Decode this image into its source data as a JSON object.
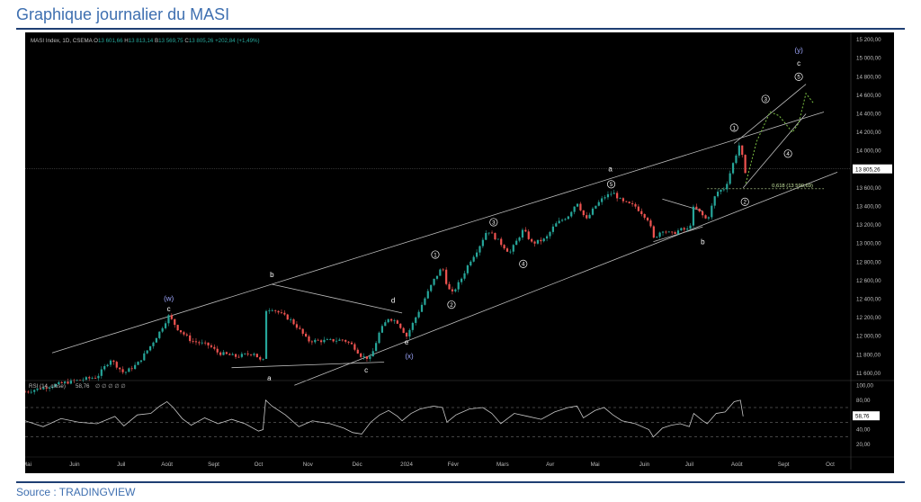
{
  "page_title": "Graphique journalier du MASI",
  "source": "Source : TRADINGVIEW",
  "colors": {
    "up": "#26a69a",
    "down": "#ef5350",
    "rsi": "#c8c8c8",
    "rsi_ob": "#26a69a",
    "fib": "#c8e6a0",
    "forecast": "#7bc043",
    "wave_label": "#ffffff",
    "wave_major": "#9fa8ff",
    "line": "#bdbdbd"
  },
  "chart_data": {
    "type": "candlestick",
    "header": {
      "symbol": "MASI Index, 1D, CSEMA",
      "open_label": "O",
      "open": "13 601,66",
      "high_label": "H",
      "high": "13 813,14",
      "low_label": "B",
      "low": "13 569,75",
      "close_label": "C",
      "close": "13 805,26",
      "change": "+202,84 (+1,49%)"
    },
    "price_ticks": [
      "15 200,00",
      "15 000,00",
      "14 800,00",
      "14 600,00",
      "14 400,00",
      "14 200,00",
      "14 000,00",
      "13 800,00",
      "13 600,00",
      "13 400,00",
      "13 200,00",
      "13 000,00",
      "12 800,00",
      "12 600,00",
      "12 400,00",
      "12 200,00",
      "12 000,00",
      "11 800,00",
      "11 600,00"
    ],
    "price_tick_values": [
      15200,
      15000,
      14800,
      14600,
      14400,
      14200,
      14000,
      13800,
      13600,
      13400,
      13200,
      13000,
      12800,
      12600,
      12400,
      12200,
      12000,
      11800,
      11600
    ],
    "ylim": [
      11550,
      15240
    ],
    "last_price_label": "13 805,26",
    "last_price": 13805.26,
    "months": [
      "Mai",
      "Juin",
      "Juil",
      "Août",
      "Sept",
      "Oct",
      "Nov",
      "Déc",
      "2024",
      "Févr",
      "Mars",
      "Avr",
      "Mai",
      "Juin",
      "Juil",
      "Août",
      "Sept",
      "Oct"
    ],
    "close_path": [
      [
        0,
        11400
      ],
      [
        45,
        11500
      ],
      [
        80,
        11560
      ],
      [
        95,
        11750
      ],
      [
        110,
        11600
      ],
      [
        125,
        11700
      ],
      [
        140,
        11900
      ],
      [
        150,
        12050
      ],
      [
        160,
        12220
      ],
      [
        170,
        12080
      ],
      [
        185,
        11950
      ],
      [
        205,
        11900
      ],
      [
        215,
        11820
      ],
      [
        235,
        11780
      ],
      [
        255,
        11820
      ],
      [
        265,
        11700
      ],
      [
        268,
        12280
      ],
      [
        275,
        12300
      ],
      [
        295,
        12180
      ],
      [
        305,
        12080
      ],
      [
        315,
        11950
      ],
      [
        335,
        11950
      ],
      [
        355,
        11960
      ],
      [
        365,
        11900
      ],
      [
        375,
        11780
      ],
      [
        385,
        11760
      ],
      [
        395,
        12050
      ],
      [
        405,
        12200
      ],
      [
        415,
        12150
      ],
      [
        425,
        12000
      ],
      [
        435,
        12200
      ],
      [
        445,
        12400
      ],
      [
        455,
        12600
      ],
      [
        465,
        12750
      ],
      [
        470,
        12550
      ],
      [
        475,
        12450
      ],
      [
        485,
        12600
      ],
      [
        495,
        12800
      ],
      [
        505,
        12950
      ],
      [
        515,
        13150
      ],
      [
        525,
        13050
      ],
      [
        540,
        12900
      ],
      [
        555,
        13150
      ],
      [
        565,
        13000
      ],
      [
        580,
        13050
      ],
      [
        590,
        13200
      ],
      [
        605,
        13300
      ],
      [
        615,
        13450
      ],
      [
        625,
        13250
      ],
      [
        635,
        13400
      ],
      [
        645,
        13500
      ],
      [
        655,
        13550
      ],
      [
        665,
        13450
      ],
      [
        680,
        13400
      ],
      [
        695,
        13250
      ],
      [
        700,
        13050
      ],
      [
        710,
        13150
      ],
      [
        720,
        13100
      ],
      [
        730,
        13150
      ],
      [
        740,
        13150
      ],
      [
        745,
        13400
      ],
      [
        755,
        13300
      ],
      [
        760,
        13250
      ],
      [
        770,
        13550
      ],
      [
        780,
        13600
      ],
      [
        790,
        13900
      ],
      [
        797,
        14100
      ],
      [
        802,
        13700
      ],
      [
        803,
        13805
      ]
    ],
    "forecast_path": [
      [
        803,
        13650
      ],
      [
        815,
        14100
      ],
      [
        830,
        14420
      ],
      [
        840,
        14380
      ],
      [
        855,
        14200
      ],
      [
        862,
        14300
      ],
      [
        870,
        14620
      ],
      [
        878,
        14520
      ]
    ],
    "fib_label": "0,618 (13 590,69)",
    "fib_value": 13590.69,
    "wave_labels": [
      {
        "text": "(w)",
        "x": 160,
        "y": 12380,
        "cls": "major"
      },
      {
        "text": "c",
        "x": 160,
        "y": 12270,
        "cls": "minor"
      },
      {
        "text": "b",
        "x": 275,
        "y": 12640,
        "cls": "minor"
      },
      {
        "text": "a",
        "x": 272,
        "y": 11520,
        "cls": "minor"
      },
      {
        "text": "d",
        "x": 410,
        "y": 12360,
        "cls": "minor"
      },
      {
        "text": "e",
        "x": 425,
        "y": 11910,
        "cls": "minor"
      },
      {
        "text": "(x)",
        "x": 428,
        "y": 11760,
        "cls": "major"
      },
      {
        "text": "c",
        "x": 380,
        "y": 11610,
        "cls": "minor"
      },
      {
        "text": "1",
        "x": 457,
        "y": 12880,
        "cls": "circle"
      },
      {
        "text": "2",
        "x": 475,
        "y": 12340,
        "cls": "circle"
      },
      {
        "text": "3",
        "x": 522,
        "y": 13230,
        "cls": "circle"
      },
      {
        "text": "4",
        "x": 555,
        "y": 12780,
        "cls": "circle"
      },
      {
        "text": "5",
        "x": 653,
        "y": 13640,
        "cls": "circle"
      },
      {
        "text": "a",
        "x": 652,
        "y": 13780,
        "cls": "minor"
      },
      {
        "text": "b",
        "x": 755,
        "y": 12990,
        "cls": "minor"
      },
      {
        "text": "1",
        "x": 790,
        "y": 14250,
        "cls": "circle"
      },
      {
        "text": "2",
        "x": 802,
        "y": 13450,
        "cls": "circle"
      },
      {
        "text": "3",
        "x": 825,
        "y": 14560,
        "cls": "circle"
      },
      {
        "text": "4",
        "x": 850,
        "y": 13970,
        "cls": "circle"
      },
      {
        "text": "5",
        "x": 862,
        "y": 14800,
        "cls": "circle"
      },
      {
        "text": "c",
        "x": 862,
        "y": 14920,
        "cls": "minor"
      },
      {
        "text": "(y)",
        "x": 862,
        "y": 15060,
        "cls": "major"
      }
    ],
    "trendlines": [
      [
        [
          30,
          11820
        ],
        [
          890,
          14420
        ]
      ],
      [
        [
          300,
          11470
        ],
        [
          905,
          13770
        ]
      ],
      [
        [
          28,
          0
        ],
        [
          0,
          0
        ]
      ]
    ],
    "rsi": {
      "label": "RSI (14, close)",
      "value_label": "58,76",
      "value": 58.76,
      "extra": "∅ ∅ ∅ ∅ ∅",
      "ticks": [
        "100,00",
        "80,00",
        "60,00",
        "40,00",
        "20,00"
      ],
      "tick_values": [
        100,
        80,
        60,
        40,
        20
      ],
      "ylim": [
        15,
        103
      ],
      "levels": [
        70,
        50,
        30
      ],
      "path": [
        [
          0,
          52
        ],
        [
          20,
          44
        ],
        [
          40,
          55
        ],
        [
          60,
          50
        ],
        [
          80,
          48
        ],
        [
          100,
          58
        ],
        [
          110,
          45
        ],
        [
          125,
          60
        ],
        [
          140,
          62
        ],
        [
          150,
          72
        ],
        [
          158,
          78
        ],
        [
          165,
          70
        ],
        [
          175,
          55
        ],
        [
          185,
          46
        ],
        [
          200,
          56
        ],
        [
          215,
          48
        ],
        [
          230,
          54
        ],
        [
          245,
          48
        ],
        [
          260,
          38
        ],
        [
          265,
          40
        ],
        [
          268,
          80
        ],
        [
          275,
          72
        ],
        [
          290,
          60
        ],
        [
          305,
          44
        ],
        [
          320,
          52
        ],
        [
          340,
          48
        ],
        [
          355,
          42
        ],
        [
          365,
          36
        ],
        [
          375,
          34
        ],
        [
          385,
          50
        ],
        [
          395,
          60
        ],
        [
          405,
          66
        ],
        [
          415,
          58
        ],
        [
          420,
          52
        ],
        [
          430,
          62
        ],
        [
          440,
          68
        ],
        [
          455,
          72
        ],
        [
          465,
          70
        ],
        [
          470,
          50
        ],
        [
          480,
          60
        ],
        [
          495,
          68
        ],
        [
          510,
          70
        ],
        [
          520,
          62
        ],
        [
          530,
          48
        ],
        [
          545,
          62
        ],
        [
          560,
          58
        ],
        [
          575,
          54
        ],
        [
          590,
          64
        ],
        [
          605,
          70
        ],
        [
          615,
          72
        ],
        [
          622,
          56
        ],
        [
          635,
          66
        ],
        [
          645,
          70
        ],
        [
          655,
          60
        ],
        [
          665,
          52
        ],
        [
          680,
          48
        ],
        [
          695,
          40
        ],
        [
          700,
          30
        ],
        [
          710,
          42
        ],
        [
          720,
          46
        ],
        [
          730,
          48
        ],
        [
          740,
          44
        ],
        [
          745,
          62
        ],
        [
          755,
          52
        ],
        [
          760,
          48
        ],
        [
          770,
          62
        ],
        [
          780,
          64
        ],
        [
          790,
          78
        ],
        [
          797,
          80
        ],
        [
          800,
          58
        ]
      ]
    },
    "x_range": [
      0,
      900
    ]
  }
}
